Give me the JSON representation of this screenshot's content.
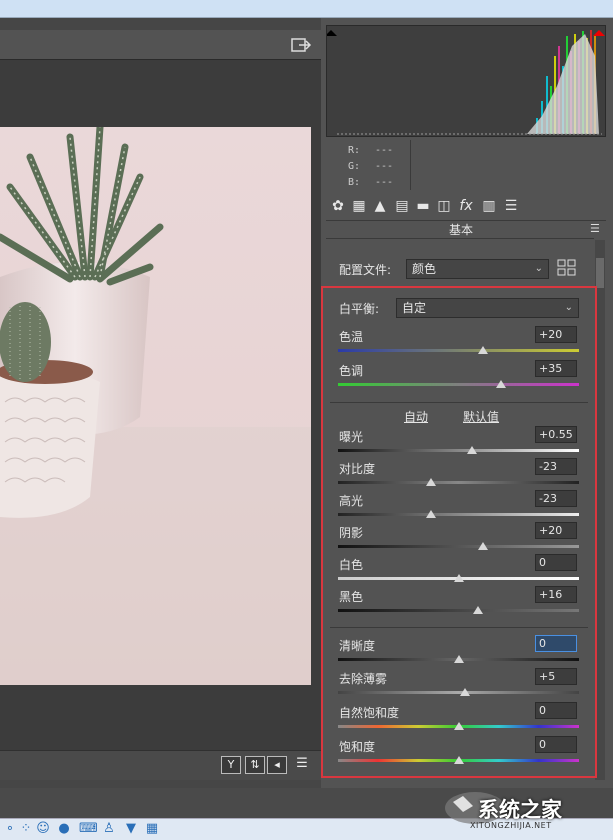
{
  "panel": {
    "title": "基本",
    "profile_label": "配置文件:",
    "profile_value": "颜色",
    "wb_label": "白平衡:",
    "wb_value": "自定",
    "auto_link": "自动",
    "default_link": "默认值"
  },
  "readout": {
    "r_label": "R:",
    "r_value": "---",
    "g_label": "G:",
    "g_value": "---",
    "b_label": "B:",
    "b_value": "---"
  },
  "sliders": [
    {
      "label": "色温",
      "value": "+20",
      "level": 0.6
    },
    {
      "label": "色调",
      "value": "+35",
      "level": 0.675
    },
    {
      "label": "曝光",
      "value": "+0.55",
      "level": 0.555
    },
    {
      "label": "对比度",
      "value": "-23",
      "level": 0.385
    },
    {
      "label": "高光",
      "value": "-23",
      "level": 0.385
    },
    {
      "label": "阴影",
      "value": "+20",
      "level": 0.6
    },
    {
      "label": "白色",
      "value": "0",
      "level": 0.5
    },
    {
      "label": "黑色",
      "value": "+16",
      "level": 0.58
    },
    {
      "label": "清晰度",
      "value": "0",
      "level": 0.5
    },
    {
      "label": "去除薄雾",
      "value": "+5",
      "level": 0.525
    },
    {
      "label": "自然饱和度",
      "value": "0",
      "level": 0.5
    },
    {
      "label": "饱和度",
      "value": "0",
      "level": 0.5
    }
  ],
  "toolbar_icons": [
    "aperture-icon",
    "grid-icon",
    "mountain-icon",
    "split-tone-icon",
    "half-icon",
    "lens-icon",
    "fx-icon",
    "film-icon",
    "sliders-icon"
  ],
  "bottom_icons": {
    "y_label": "Y",
    "a_label": "⇅",
    "b_label": "◂",
    "c_label": "☰"
  },
  "watermark": {
    "text": "系统之家",
    "sub": "XITONGZHIJIA.NET"
  },
  "colors": {
    "highlight_box": "#d9373f",
    "panel_bg": "#535353"
  }
}
